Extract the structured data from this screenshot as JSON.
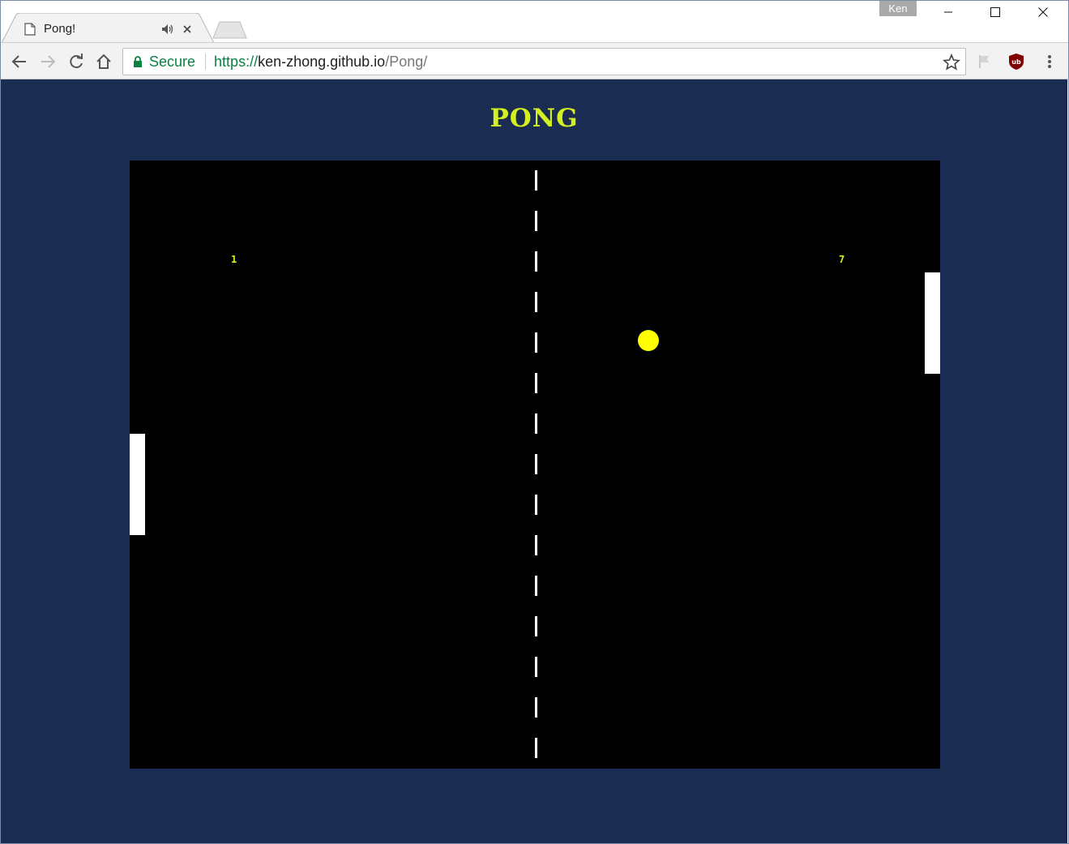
{
  "browser": {
    "tab": {
      "title": "Pong!"
    },
    "profile": {
      "name": "Ken"
    },
    "omnibox": {
      "security_label": "Secure",
      "url_scheme": "https://",
      "url_host": "ken-zhong.github.io",
      "url_path": "/Pong/"
    },
    "icons": {
      "back": "back-arrow-icon",
      "forward": "forward-arrow-icon",
      "reload": "reload-icon",
      "home": "home-icon",
      "lock": "lock-icon",
      "bookmark": "star-icon",
      "extension_flag": "flag-icon",
      "extension_ublock": "ublock-shield-icon",
      "menu": "kebab-menu-icon"
    }
  },
  "page": {
    "title": "PONG",
    "colors": {
      "background": "#1a2c52",
      "title": "#d4ef22",
      "court": "#000000",
      "paddle": "#ffffff",
      "ball": "#ffff00",
      "score": "#d8ef1c"
    }
  },
  "game": {
    "score_left": "1",
    "score_right": "7"
  }
}
